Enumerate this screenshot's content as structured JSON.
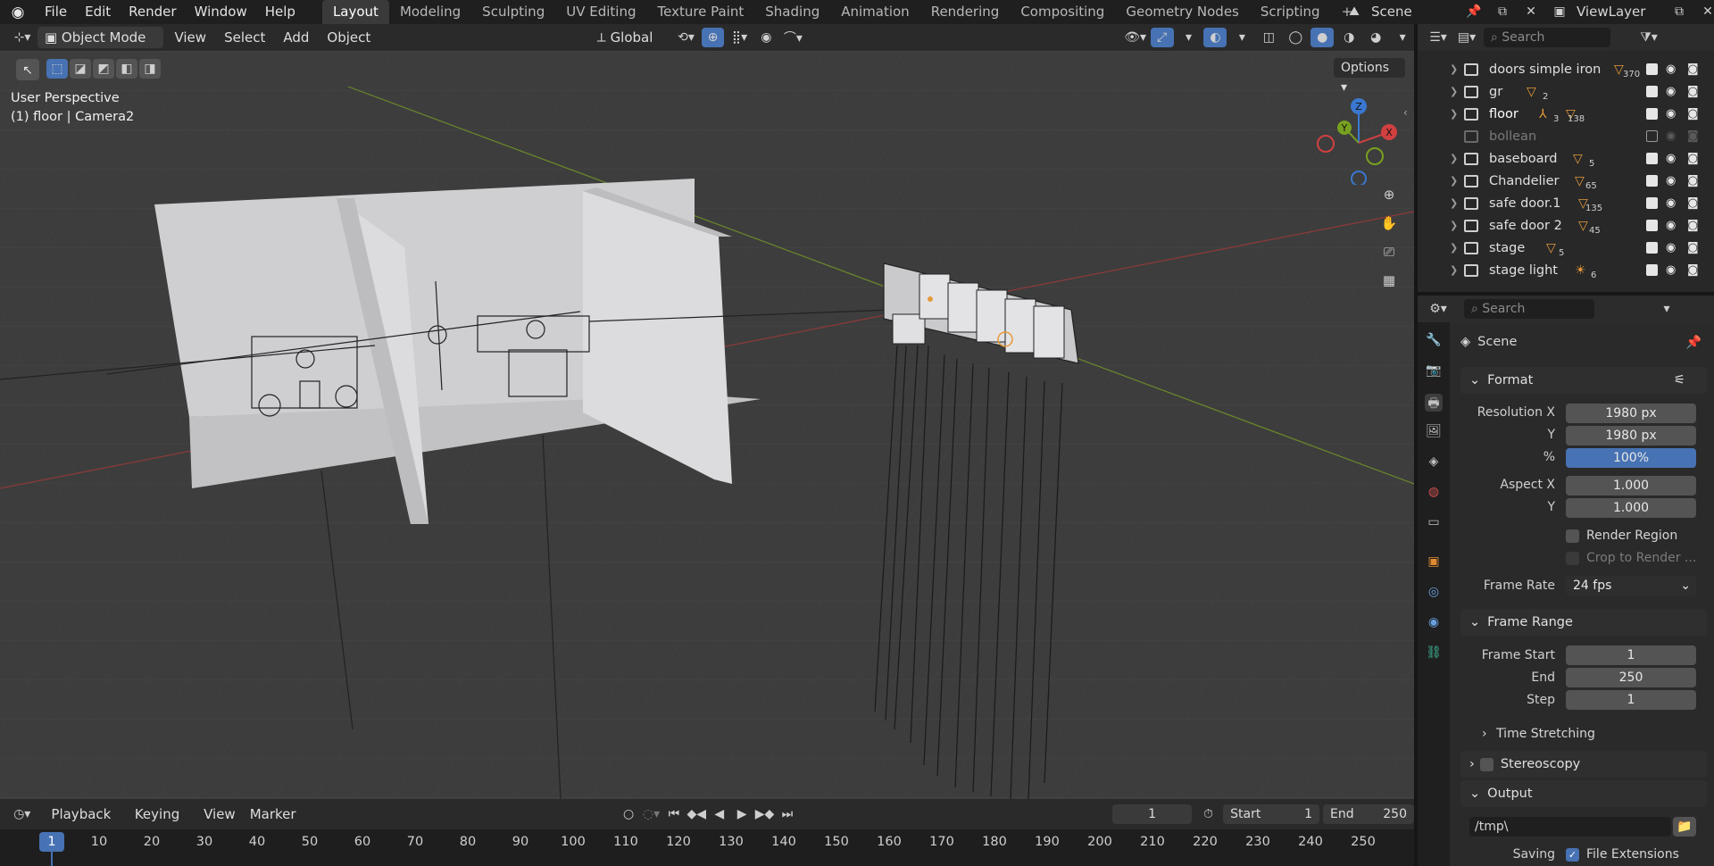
{
  "menus": [
    "File",
    "Edit",
    "Render",
    "Window",
    "Help"
  ],
  "workspaces": [
    {
      "label": "Layout",
      "active": true
    },
    {
      "label": "Modeling"
    },
    {
      "label": "Sculpting"
    },
    {
      "label": "UV Editing"
    },
    {
      "label": "Texture Paint"
    },
    {
      "label": "Shading"
    },
    {
      "label": "Animation"
    },
    {
      "label": "Rendering"
    },
    {
      "label": "Compositing"
    },
    {
      "label": "Geometry Nodes"
    },
    {
      "label": "Scripting"
    }
  ],
  "add_workspace": "+",
  "scene_name": "Scene",
  "view_layer": "ViewLayer",
  "viewport": {
    "mode": "Object Mode",
    "menus": [
      "View",
      "Select",
      "Add",
      "Object"
    ],
    "orientation": "Global",
    "options_label": "Options",
    "perspective_text": "User Perspective",
    "context_text": "(1) floor | Camera2",
    "gizmo_axes": {
      "z": "Z",
      "y": "Y",
      "x": "X"
    }
  },
  "outliner": {
    "search_placeholder": "Search",
    "rows": [
      {
        "name": "doors simple iron",
        "count": "370",
        "muted": false
      },
      {
        "name": "gr",
        "count": "2",
        "muted": false
      },
      {
        "name": "floor",
        "count": "138",
        "sub": "3",
        "muted": false,
        "highlight": true
      },
      {
        "name": "bollean",
        "count": "",
        "muted": true
      },
      {
        "name": "baseboard",
        "count": "5",
        "muted": false
      },
      {
        "name": "Chandelier",
        "count": "65",
        "muted": false
      },
      {
        "name": "safe door.1",
        "count": "135",
        "muted": false
      },
      {
        "name": "safe door 2",
        "count": "45",
        "muted": false
      },
      {
        "name": "stage",
        "count": "5",
        "muted": false
      },
      {
        "name": "stage light",
        "count": "6",
        "muted": false
      }
    ]
  },
  "properties": {
    "search_placeholder": "Search",
    "context": "Scene",
    "format": {
      "title": "Format",
      "resolution_x_label": "Resolution X",
      "resolution_x": "1980 px",
      "resolution_y_label": "Y",
      "resolution_y": "1980 px",
      "percent_label": "%",
      "percent": "100%",
      "aspect_x_label": "Aspect X",
      "aspect_x": "1.000",
      "aspect_y_label": "Y",
      "aspect_y": "1.000",
      "render_region": "Render Region",
      "crop": "Crop to Render ...",
      "frame_rate_label": "Frame Rate",
      "frame_rate": "24 fps"
    },
    "frame_range": {
      "title": "Frame Range",
      "start_label": "Frame Start",
      "start": "1",
      "end_label": "End",
      "end": "250",
      "step_label": "Step",
      "step": "1",
      "time_stretching": "Time Stretching"
    },
    "stereoscopy": "Stereoscopy",
    "output": {
      "title": "Output",
      "path": "/tmp\\",
      "saving_label": "Saving",
      "file_extensions": "File Extensions"
    }
  },
  "timeline": {
    "menus": [
      "Playback",
      "Keying",
      "View",
      "Marker"
    ],
    "current_frame": "1",
    "start_label": "Start",
    "start": "1",
    "end_label": "End",
    "end": "250",
    "ticks": [
      "1",
      "10",
      "20",
      "30",
      "40",
      "50",
      "60",
      "70",
      "80",
      "90",
      "100",
      "110",
      "120",
      "130",
      "140",
      "150",
      "160",
      "170",
      "180",
      "190",
      "200",
      "210",
      "220",
      "230",
      "240",
      "250"
    ]
  },
  "colors": {
    "accent": "#4772b3",
    "selection": "#e59a3a",
    "background": "#3d3d3d"
  }
}
